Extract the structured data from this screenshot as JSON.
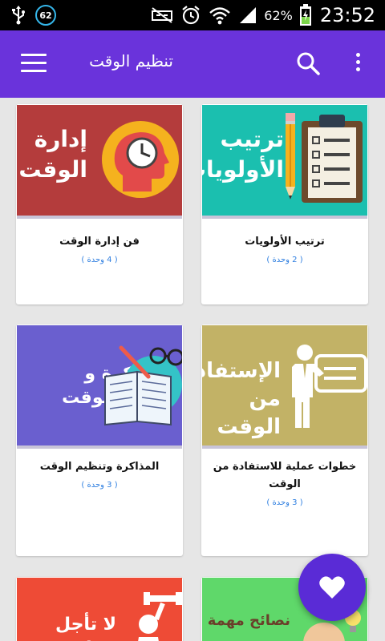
{
  "status_bar": {
    "notification_count": "62",
    "battery_percent": "62%",
    "time": "23:52"
  },
  "app_bar": {
    "title": "تنظيم الوقت",
    "accent_color": "#6a33db"
  },
  "cards": [
    {
      "title": "ترتيب الأولويات",
      "count": "( 2 وحدة )",
      "image_text": [
        "ترتيب",
        "الأولويات"
      ],
      "image_bg": "#1bbfaf"
    },
    {
      "title": "فن إدارة الوقت",
      "count": "( 4 وحدة )",
      "image_text": [
        "إدارة",
        "الوقت"
      ],
      "image_bg": "#b43c3c"
    },
    {
      "title": "خطوات عملية للاستفادة من الوقت",
      "count": "( 3 وحدة )",
      "image_text": [
        "الإستفادة",
        "من الوقت"
      ],
      "image_bg": "#c2b266"
    },
    {
      "title": "المذاكرة وتنظيم الوقت",
      "count": "( 3 وحدة )",
      "image_text": [
        "المذاكرة و",
        "تنظيم الوقت"
      ],
      "image_bg": "#6a5fcf"
    },
    {
      "title": "",
      "count": "",
      "image_text": [
        "نصائح مهمة"
      ],
      "image_bg": "#5fd86a"
    },
    {
      "title": "",
      "count": "",
      "image_text": [
        "لا تأجل عمل"
      ],
      "image_bg": "#ee4b36"
    }
  ],
  "fab": {
    "icon": "heart-icon",
    "color": "#5a2bd6"
  }
}
